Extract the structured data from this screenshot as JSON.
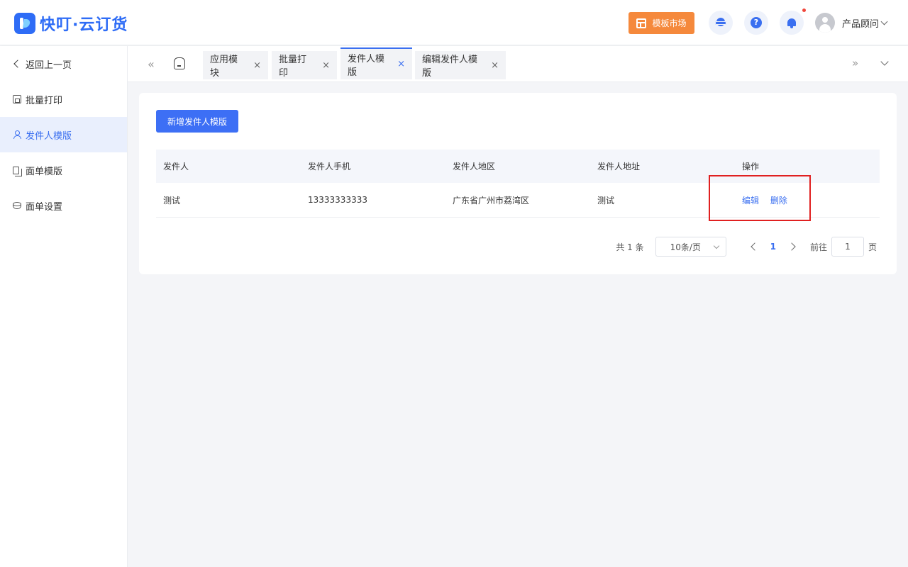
{
  "header": {
    "logo_text": "快叮·云订货",
    "market_label": "模板市场",
    "user_name": "产品顾问"
  },
  "sidebar": {
    "items": [
      {
        "label": "返回上一页",
        "icon": "back-icon"
      },
      {
        "label": "批量打印",
        "icon": "printer-icon"
      },
      {
        "label": "发件人模版",
        "icon": "user-icon",
        "active": true
      },
      {
        "label": "面单模版",
        "icon": "document-icon"
      },
      {
        "label": "面单设置",
        "icon": "settings-stack-icon"
      }
    ]
  },
  "tabs": [
    {
      "label": "应用模块"
    },
    {
      "label": "批量打印"
    },
    {
      "label": "发件人模版",
      "active": true
    },
    {
      "label": "编辑发件人模版"
    }
  ],
  "main": {
    "add_button": "新增发件人模版",
    "columns": [
      "发件人",
      "发件人手机",
      "发件人地区",
      "发件人地址",
      "操作"
    ],
    "rows": [
      {
        "sender": "测试",
        "phone": "13333333333",
        "region": "广东省广州市荔湾区",
        "address": "测试",
        "edit": "编辑",
        "delete": "删除"
      }
    ],
    "pagination": {
      "total": "共 1 条",
      "page_size": "10条/页",
      "current_page": "1",
      "goto_label": "前往",
      "goto_value": "1",
      "page_suffix": "页"
    }
  },
  "colors": {
    "primary": "#3a6ff0",
    "market": "#f5893c",
    "highlight": "#e02020"
  }
}
